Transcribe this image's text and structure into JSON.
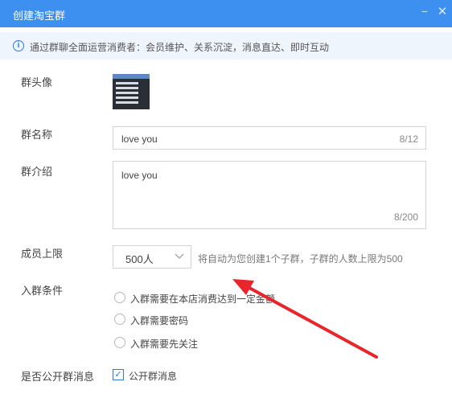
{
  "window": {
    "title": "创建淘宝群",
    "minimize_glyph": "−",
    "close_glyph": "✕"
  },
  "info": {
    "icon": "i",
    "text": "通过群聊全面运营消费者：会员维护、关系沉淀，消息直达、即时互动"
  },
  "form": {
    "avatar_label": "群头像",
    "name_label": "群名称",
    "name_value": "love you",
    "name_counter": "8/12",
    "intro_label": "群介绍",
    "intro_value": "love you",
    "intro_counter": "8/200",
    "limit_label": "成员上限",
    "limit_value": "500人",
    "limit_hint": "将自动为您创建1个子群，子群的人数上限为500",
    "condition_label": "入群条件",
    "conditions": [
      "入群需要在本店消费达到一定金额",
      "入群需要密码",
      "入群需要先关注"
    ],
    "public_label": "是否公开群消息",
    "public_option": "公开群消息",
    "public_checked": true
  },
  "annotation": {
    "arrow_color": "#e8252b"
  },
  "colors": {
    "titlebar": "#3d8ff0",
    "infobar": "#eef5fd",
    "accent": "#2b79df"
  }
}
